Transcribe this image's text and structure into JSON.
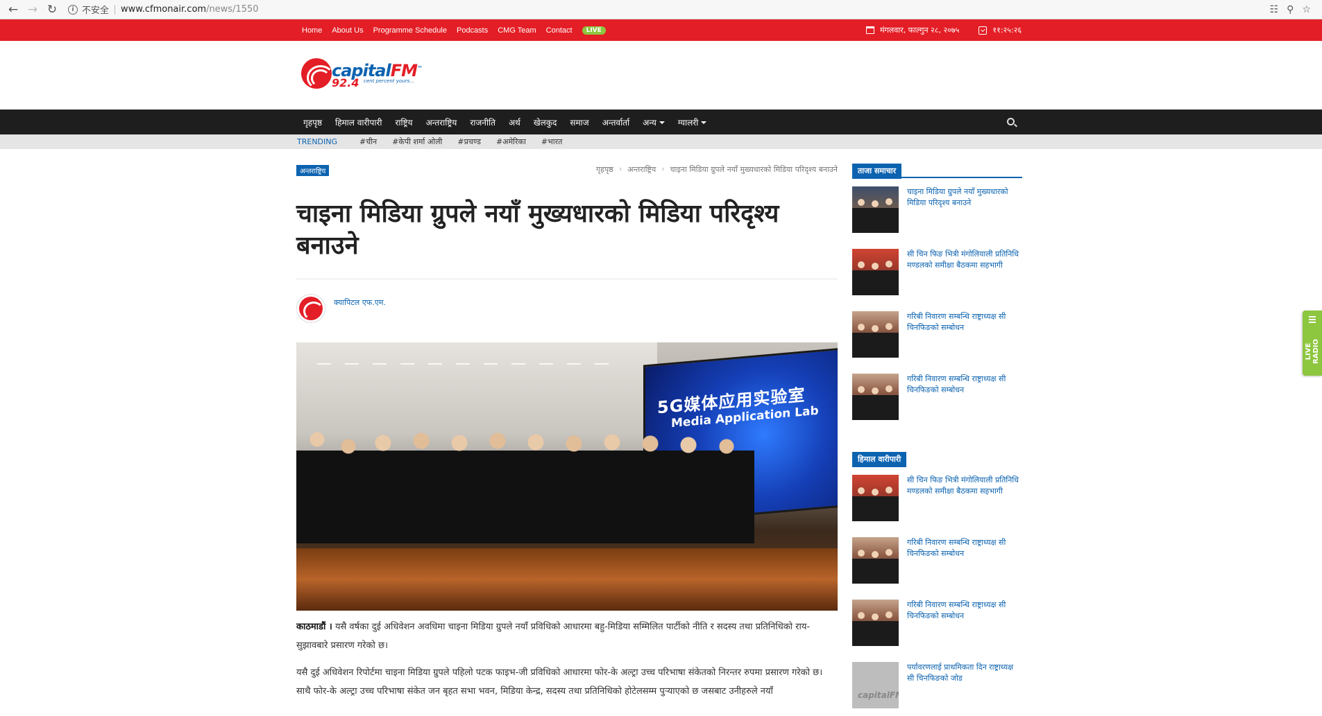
{
  "browser": {
    "security_label": "不安全",
    "url_host": "www.cfmonair.com",
    "url_path": "/news/1550"
  },
  "topbar": {
    "links": [
      "Home",
      "About Us",
      "Programme Schedule",
      "Podcasts",
      "CMG Team",
      "Contact"
    ],
    "live_label": "LIVE",
    "date": "मंगलवार, फाल्गुन २८, २०७५",
    "time": "११:२५:२६"
  },
  "logo": {
    "name_part1": "capital",
    "name_part2": "FM",
    "trademark": "™",
    "frequency": "92.4",
    "tagline": "cent percent yours..."
  },
  "mainnav": {
    "items": [
      "गृहपृष्ठ",
      "हिमाल वारीपारी",
      "राष्ट्रिय",
      "अन्तराष्ट्रिय",
      "राजनीति",
      "अर्थ",
      "खेलकुद",
      "समाज",
      "अन्तर्वार्ता"
    ],
    "more_label": "अन्य",
    "gallery_label": "ग्यालरी"
  },
  "trending": {
    "label": "TRENDING",
    "tags": [
      "#चीन",
      "#केपी शर्मा ओली",
      "#प्रचण्ड",
      "#अमेरिका",
      "#भारत"
    ]
  },
  "article": {
    "category": "अन्तराष्ट्रिय",
    "breadcrumb": [
      "गृहपृष्ठ",
      "अन्तराष्ट्रिय",
      "चाइना मिडिया ग्रुपले नयाँ मुख्यधारको मिडिया परिदृश्य बनाउने"
    ],
    "headline": "चाइना मिडिया ग्रुपले नयाँ मुख्यधारको मिडिया परिदृश्य बनाउने",
    "author": "क्यापिटल एफ.एम.",
    "hero_screen_title": "5G媒体应用实验室",
    "hero_screen_subtitle": "Media Application Lab",
    "dateline": "काठमाडौं ।",
    "para1": "यसै वर्षका दुई अधिवेशन अवधिमा चाइना मिडिया ग्रुपले नयाँ प्रविधिको आधारमा बहु-मिडिया सम्मिलित पार्टीको नीति र सदस्य तथा प्रतिनिधिको राय-सुझावबारे प्रसारण गरेको छ।",
    "para2": "यसै दुई अधिवेशन रिपोर्टमा चाइना मिडिया ग्रुपले पहिलो पटक फाइभ-जी प्रविधिको आधारमा फोर-के अल्ट्रा उच्च परिभाषा संकेतको निरन्तर रुपमा प्रसारण गरेको छ। साथै फोर-के अल्ट्रा उच्च परिभाषा संकेत जन बृहत सभा भवन, मिडिया केन्द्र, सदस्य तथा प्रतिनिधिको होटेलसम्म पुऱ्याएको छ जसबाट उनीहरुले नयाँ"
  },
  "sidebar": {
    "latest_heading": "ताजा समाचार",
    "latest": [
      "चाइना मिडिया ग्रुपले नयाँ मुख्यधारको मिडिया परिदृश्य बनाउने",
      "सी चिन फिङ भित्री मंगोलियाली प्रतिनिधि मण्डलको समीक्षा बैठकमा सहभागी",
      "गरिबी निवारण सम्बन्धि राष्ट्राध्यक्ष सी चिनफिङको सम्बोधन",
      "गरिबी निवारण सम्बन्धि राष्ट्राध्यक्ष सी चिनफिङको सम्बोधन"
    ],
    "himal_heading": "हिमाल वारीपारी",
    "himal": [
      "सी चिन फिङ भित्री मंगोलियाली प्रतिनिधि मण्डलको समीक्षा बैठकमा सहभागी",
      "गरिबी निवारण सम्बन्धि राष्ट्राध्यक्ष सी चिनफिङको सम्बोधन",
      "गरिबी निवारण सम्बन्धि राष्ट्राध्यक्ष सी चिनफिङको सम्बोधन",
      "पर्यावरणलाई प्राथमिकता दिन राष्ट्राध्यक्ष सी चिनफिङको जोड"
    ]
  },
  "live_radio": {
    "label": "LIVE RADIO"
  },
  "colors": {
    "brand_red": "#e41e26",
    "brand_blue": "#0c63b0",
    "live_green": "#8dc63f",
    "nav_dark": "#1e1e1e"
  }
}
